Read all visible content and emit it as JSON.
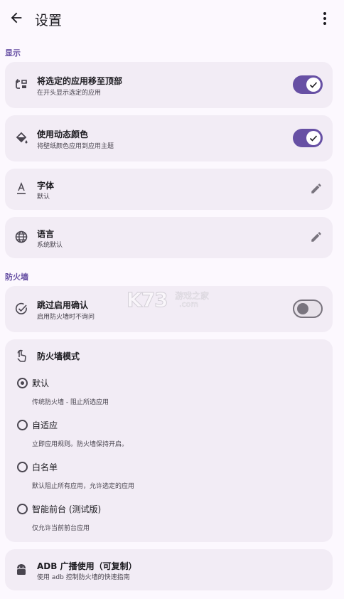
{
  "appbar": {
    "title": "设置"
  },
  "sections": {
    "display": "显示",
    "firewall": "防火墙"
  },
  "display": {
    "move_top": {
      "title": "将选定的应用移至顶部",
      "subtitle": "在开头显示选定的应用",
      "enabled": true
    },
    "dynamic_color": {
      "title": "使用动态颜色",
      "subtitle": "将壁纸颜色应用到应用主题",
      "enabled": true
    },
    "font": {
      "title": "字体",
      "subtitle": "默认"
    },
    "language": {
      "title": "语言",
      "subtitle": "系统默认"
    }
  },
  "firewall": {
    "skip_confirm": {
      "title": "跳过启用确认",
      "subtitle": "启用防火墙时不询问",
      "enabled": false
    },
    "mode": {
      "title": "防火墙模式",
      "selected": 0,
      "options": [
        {
          "label": "默认",
          "desc": "传统防火墙 - 阻止所选应用"
        },
        {
          "label": "自适应",
          "desc": "立即应用规则。防火墙保持开启。"
        },
        {
          "label": "白名单",
          "desc": "默认阻止所有应用，允许选定的应用"
        },
        {
          "label": "智能前台 (测试版)",
          "desc": "仅允许当前前台应用"
        }
      ]
    },
    "adb": {
      "title": "ADB 广播使用（可复制）",
      "subtitle": "使用 adb 控制防火墙的快速指南"
    }
  },
  "watermark": {
    "brand": "K73",
    "tagline": "游戏之家",
    "domain": ".com"
  },
  "colors": {
    "accent": "#6750A4",
    "card": "#F2ECF5",
    "background": "#FCF8FE"
  }
}
